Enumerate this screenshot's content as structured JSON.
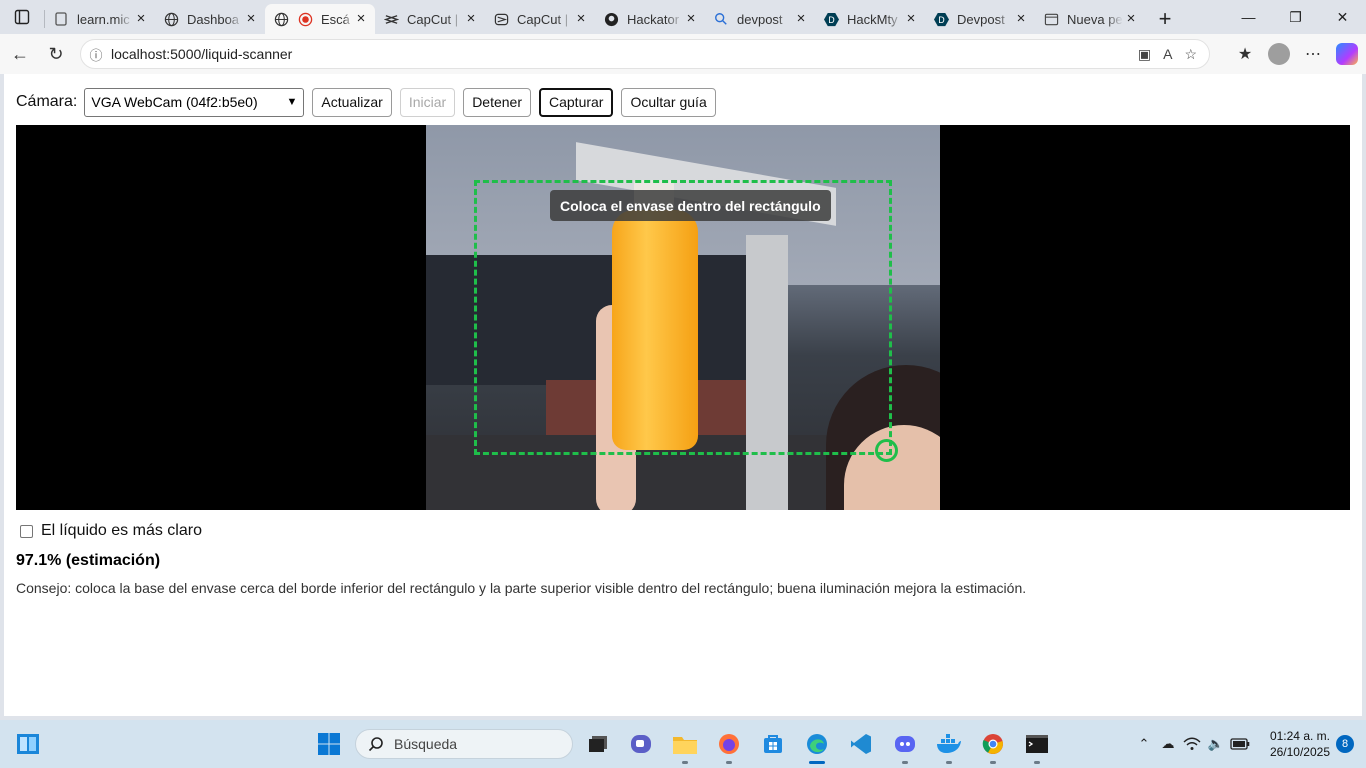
{
  "browser": {
    "tabs": [
      {
        "title": "learn.mic",
        "icon": "document-icon",
        "active": false
      },
      {
        "title": "Dashboa",
        "icon": "globe-icon",
        "active": false
      },
      {
        "title": "Escá",
        "icon": "globe-icon",
        "active": true
      },
      {
        "title": "CapCut |",
        "icon": "capcut-icon",
        "active": false
      },
      {
        "title": "CapCut |",
        "icon": "capcut-icon",
        "active": false
      },
      {
        "title": "Hackator",
        "icon": "github-icon",
        "active": false
      },
      {
        "title": "devpost",
        "icon": "search-icon",
        "active": false
      },
      {
        "title": "HackMty",
        "icon": "devpost-icon",
        "active": false
      },
      {
        "title": "Devpost",
        "icon": "devpost-icon",
        "active": false
      },
      {
        "title": "Nueva pe",
        "icon": "newtab-icon",
        "active": false
      }
    ],
    "url": "localhost:5000/liquid-scanner"
  },
  "page": {
    "camera_label": "Cámara:",
    "camera_selected": "VGA WebCam (04f2:b5e0)",
    "buttons": {
      "refresh": "Actualizar",
      "start": "Iniciar",
      "stop": "Detener",
      "capture": "Capturar",
      "hide_guide": "Ocultar guía"
    },
    "overlay_hint": "Coloca el envase dentro del rectángulo",
    "checkbox_label": "El líquido es más claro",
    "checkbox_checked": false,
    "result": "97.1% (estimación)",
    "tip": "Consejo: coloca la base del envase cerca del borde inferior del rectángulo y la parte superior visible dentro del rectángulo; buena iluminación mejora la estimación."
  },
  "taskbar": {
    "search_placeholder": "Búsqueda",
    "time": "01:24 a. m.",
    "date": "26/10/2025",
    "notification_count": "8"
  },
  "colors": {
    "guide": "#1fbe4a",
    "accent": "#0067c0"
  }
}
